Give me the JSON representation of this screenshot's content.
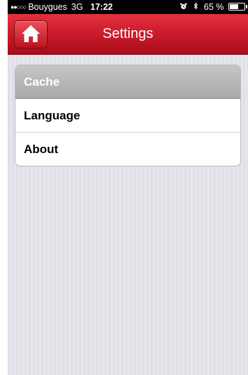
{
  "status_bar": {
    "signal": "●●○○○",
    "carrier": "Bouygues",
    "network": "3G",
    "time": "17:22",
    "battery": "65 %",
    "battery_level": 0.65,
    "icons": [
      "alarm-clock-icon",
      "bluetooth-icon",
      "battery-icon"
    ]
  },
  "nav": {
    "title": "Settings",
    "home_icon": "home-icon"
  },
  "settings": {
    "items": [
      {
        "label": "Cache",
        "selected": true
      },
      {
        "label": "Language",
        "selected": false
      },
      {
        "label": "About",
        "selected": false
      }
    ]
  },
  "colors": {
    "nav_bar": "#c91b2b",
    "background": "#e2e3e8",
    "selected_row": "#b5b5b5"
  }
}
